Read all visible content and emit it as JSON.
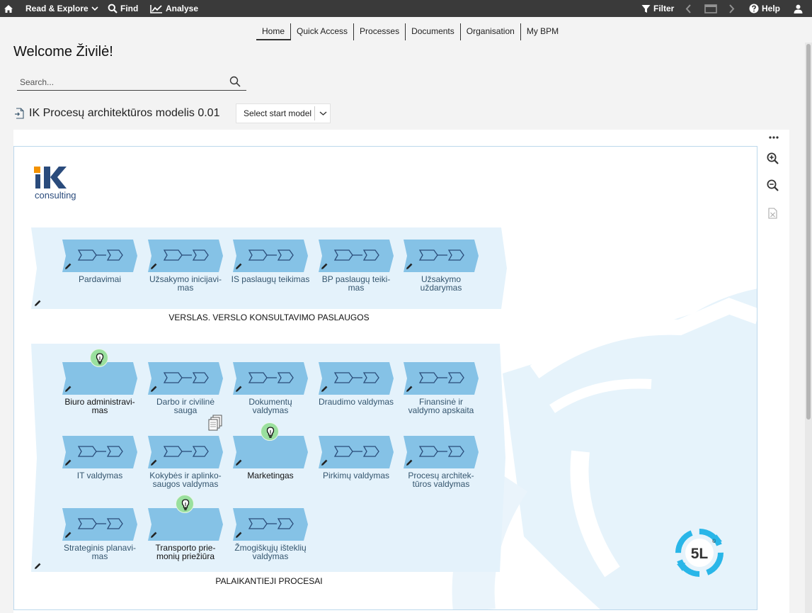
{
  "topbar": {
    "read_explore": "Read & Explore",
    "find": "Find",
    "analyse": "Analyse",
    "filter": "Filter",
    "help": "Help"
  },
  "nav": {
    "tabs": [
      "Home",
      "Quick Access",
      "Processes",
      "Documents",
      "Organisation",
      "My BPM"
    ],
    "active": "Home"
  },
  "welcome": "Welcome Živilė!",
  "search": {
    "placeholder": "Search..."
  },
  "model": {
    "title": "IK Procesų architektūros modelis 0.01",
    "start_model_label": "Select start model"
  },
  "diagram": {
    "logo": {
      "letters": "IK",
      "sub": "consulting"
    },
    "badge": "5L",
    "lane1": {
      "label": "VERSLAS. VERSLO KONSULTAVIMO PASLAUGOS",
      "processes": [
        {
          "label": "Pardavimai"
        },
        {
          "label": "Užsakymo inicijavi-\nmas"
        },
        {
          "label": "IS paslaugų teikimas"
        },
        {
          "label": "BP paslaugų teiki-\nmas"
        },
        {
          "label": "Užsakymo\nuždarymas"
        }
      ]
    },
    "lane2": {
      "label": "PALAIKANTIEJI PROCESAI",
      "processes": [
        {
          "label": "Biuro administravi-\nmas"
        },
        {
          "label": "Darbo ir civilinė\nsauga"
        },
        {
          "label": "Dokumentų\nvaldymas"
        },
        {
          "label": "Draudimo valdymas"
        },
        {
          "label": "Finansinė ir\nvaldymo apskaita"
        },
        {
          "label": "IT valdymas"
        },
        {
          "label": "Kokybės ir aplinko-\nsaugos valdymas"
        },
        {
          "label": "Marketingas"
        },
        {
          "label": "Pirkimų valdymas"
        },
        {
          "label": "Procesų architek-\ntūros valdymas"
        },
        {
          "label": "Strateginis planavi-\nmas"
        },
        {
          "label": "Transporto prie-\nmonių priežiūra"
        },
        {
          "label": "Žmogiškųjų išteklių\nvaldymas"
        }
      ]
    }
  },
  "colors": {
    "topbar": "#3a3a3a",
    "process_fill": "#85c2e6",
    "lane_fill": "#e4f2fb",
    "arrow_stroke": "#2b4d7a",
    "bulb": "#9ae09e",
    "logo_orange": "#f39200",
    "logo_blue": "#2a4b7c",
    "badge_cyan": "#29b6e8"
  }
}
